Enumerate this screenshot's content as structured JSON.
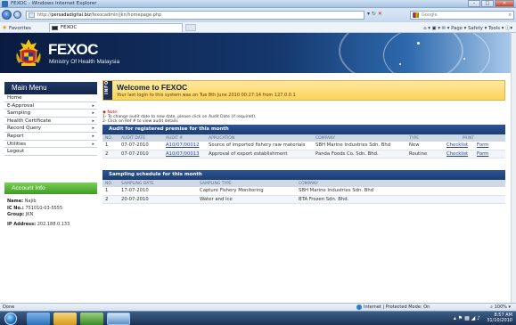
{
  "browser": {
    "window_title": "FEXOC - Windows Internet Explorer",
    "url_prefix": "http://",
    "url_domain": "persadadigital.biz",
    "url_path": "/fexocadmin/jkn/homepage.php",
    "search_placeholder": "Google",
    "favorites_label": "Favorites",
    "tab_title": "FEXOC",
    "command_bar": "Page ▾  Safety ▾  Tools ▾  ⓘ▾",
    "status_left": "Done",
    "status_zone": "Internet | Protected Mode: On",
    "zoom": "100%"
  },
  "header": {
    "brand": "FEXOC",
    "subtitle": "Ministry Of Health Malaysia"
  },
  "main_menu": {
    "title": "Main Menu",
    "items": [
      {
        "label": "Home",
        "arrow": ""
      },
      {
        "label": "E-Approval",
        "arrow": "▸"
      },
      {
        "label": "Sampling",
        "arrow": "▸"
      },
      {
        "label": "Health Certificate",
        "arrow": "▸"
      },
      {
        "label": "Record Query",
        "arrow": "▸"
      },
      {
        "label": "Report",
        "arrow": "▸"
      },
      {
        "label": "Utilities",
        "arrow": "▸"
      },
      {
        "label": "Logout",
        "arrow": ""
      }
    ]
  },
  "account": {
    "title": "Account Info",
    "name_label": "Name:",
    "name": "Najib",
    "ic_label": "IC No.:",
    "ic": "751010-03-5555",
    "group_label": "Group:",
    "group": "JKN",
    "ip_label": "IP Address:",
    "ip": "202.188.0.133"
  },
  "welcome": {
    "info_tab": "INFO",
    "title": "Welcome to FEXOC",
    "last_login": "Your last login to this system was on Tue 8th June 2010 00:27:14 from 127.0.0.1"
  },
  "notes": {
    "heading": "Note:",
    "lines": [
      "1- To change audit date to new date, please click on Audit Date (if required).",
      "2- Click on Ref # to view audit details"
    ]
  },
  "audit_table": {
    "title": "Audit for registered premise for this month",
    "columns": [
      "NO.",
      "AUDIT DATE",
      "AUDIT #",
      "APPLICATION",
      "COMPANY",
      "TYPE",
      "PRINT",
      ""
    ],
    "rows": [
      {
        "no": "1",
        "date": "07-07-2010",
        "ref": "A10/07/00012",
        "app": "Source of imported fishery raw materials",
        "company": "SBH Marine Industries Sdn. Bhd",
        "type": "New",
        "checklist": "Checklist",
        "form": "Form"
      },
      {
        "no": "2",
        "date": "07-07-2010",
        "ref": "A10/07/00013",
        "app": "Approval of export establishment",
        "company": "Panda Foods Co. Sdn. Bhd.",
        "type": "Routine",
        "checklist": "Checklist",
        "form": "Form"
      }
    ]
  },
  "sampling_table": {
    "title": "Sampling schedule for this month",
    "columns": [
      "NO.",
      "SAMPLING DATE",
      "SAMPLING TYPE",
      "COMPANY"
    ],
    "rows": [
      {
        "no": "1",
        "date": "17-07-2010",
        "type": "Capture Fishery Monitoring",
        "company": "SBH Marine Industries Sdn. Bhd"
      },
      {
        "no": "2",
        "date": "20-07-2010",
        "type": "Water and Ice",
        "company": "BTA Frozen Sdn. Bhd."
      }
    ]
  },
  "taskbar": {
    "time": "8:57 AM",
    "date": "31/10/2010"
  },
  "colors": {
    "header_navy": "#0a1b3f",
    "menu_head": "#13254a",
    "account_green": "#3f9b24",
    "welcome_yellow": "#fbd45a",
    "table_head": "#1d3d70",
    "link": "#1e3fb8"
  }
}
